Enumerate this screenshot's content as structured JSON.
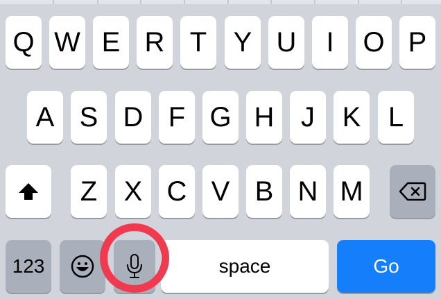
{
  "keyboard": {
    "row1": [
      "Q",
      "W",
      "E",
      "R",
      "T",
      "Y",
      "U",
      "I",
      "O",
      "P"
    ],
    "row2": [
      "A",
      "S",
      "D",
      "F",
      "G",
      "H",
      "J",
      "K",
      "L"
    ],
    "row3": [
      "Z",
      "X",
      "C",
      "V",
      "B",
      "N",
      "M"
    ],
    "numbers_label": "123",
    "space_label": "space",
    "go_label": "Go",
    "icons": {
      "shift": "shift-arrow-icon",
      "backspace": "backspace-icon",
      "emoji": "emoji-smiley-icon",
      "microphone": "microphone-icon"
    }
  },
  "annotation": {
    "type": "circle-highlight",
    "target": "microphone-key",
    "color": "#f03a4f"
  },
  "colors": {
    "background": "#d1d5db",
    "key": "#ffffff",
    "function_key": "#aab0bb",
    "go_key": "#147efb"
  }
}
